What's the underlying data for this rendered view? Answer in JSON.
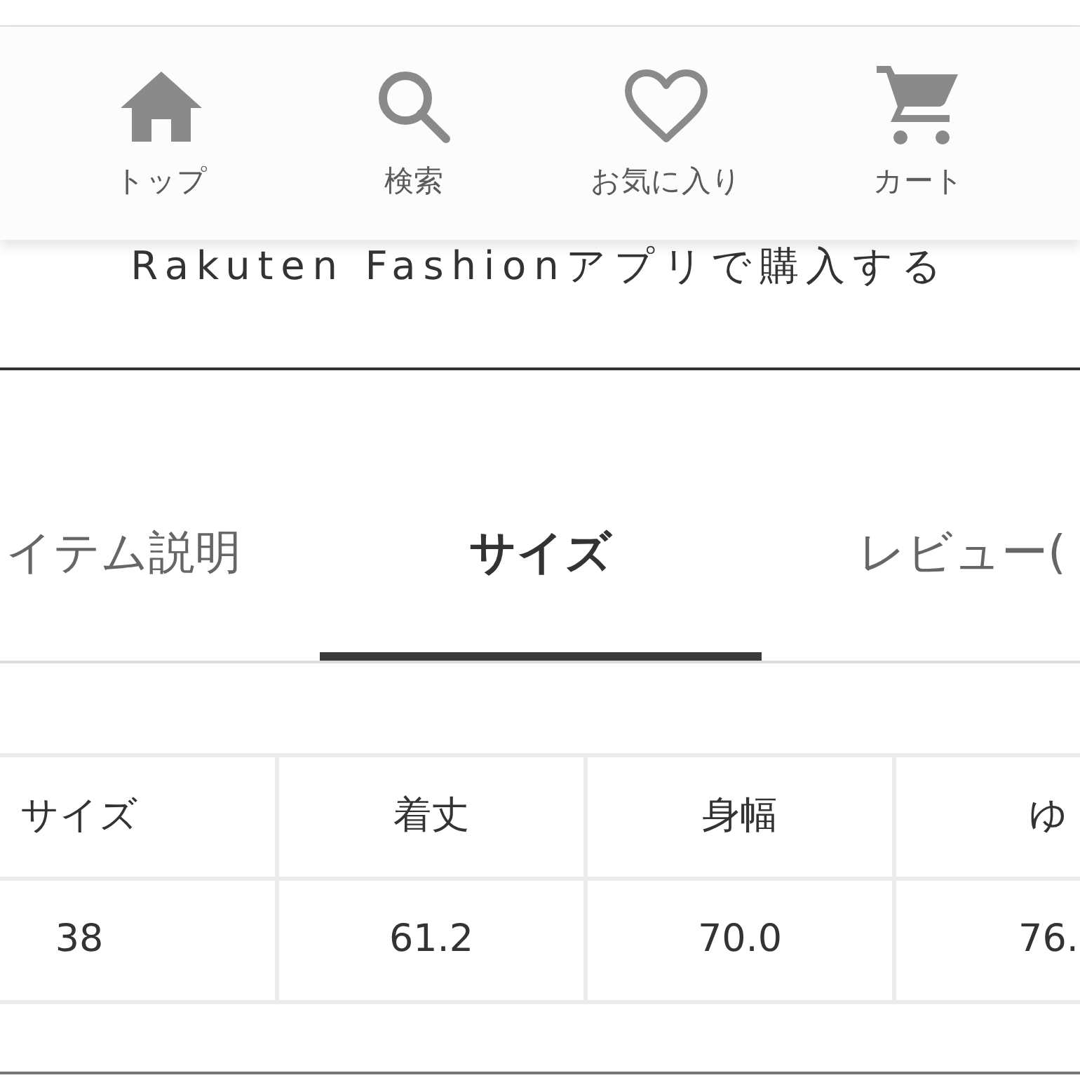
{
  "nav": [
    {
      "label": "トップ",
      "kind": "home"
    },
    {
      "label": "検索",
      "kind": "search"
    },
    {
      "label": "お気に入り",
      "kind": "heart"
    },
    {
      "label": "カート",
      "kind": "cart"
    }
  ],
  "purchase_button": {
    "label": "Rakuten Fashionアプリで購入する"
  },
  "tabs": [
    {
      "label": "イテム説明",
      "selected": false
    },
    {
      "label": "サイズ",
      "selected": true
    },
    {
      "label": "レビュー(",
      "selected": false
    }
  ],
  "size_table": {
    "columns": [
      "サイズ",
      "着丈",
      "身幅",
      "ゆ"
    ],
    "rows": [
      [
        "38",
        "61.2",
        "70.0",
        "76."
      ]
    ]
  }
}
